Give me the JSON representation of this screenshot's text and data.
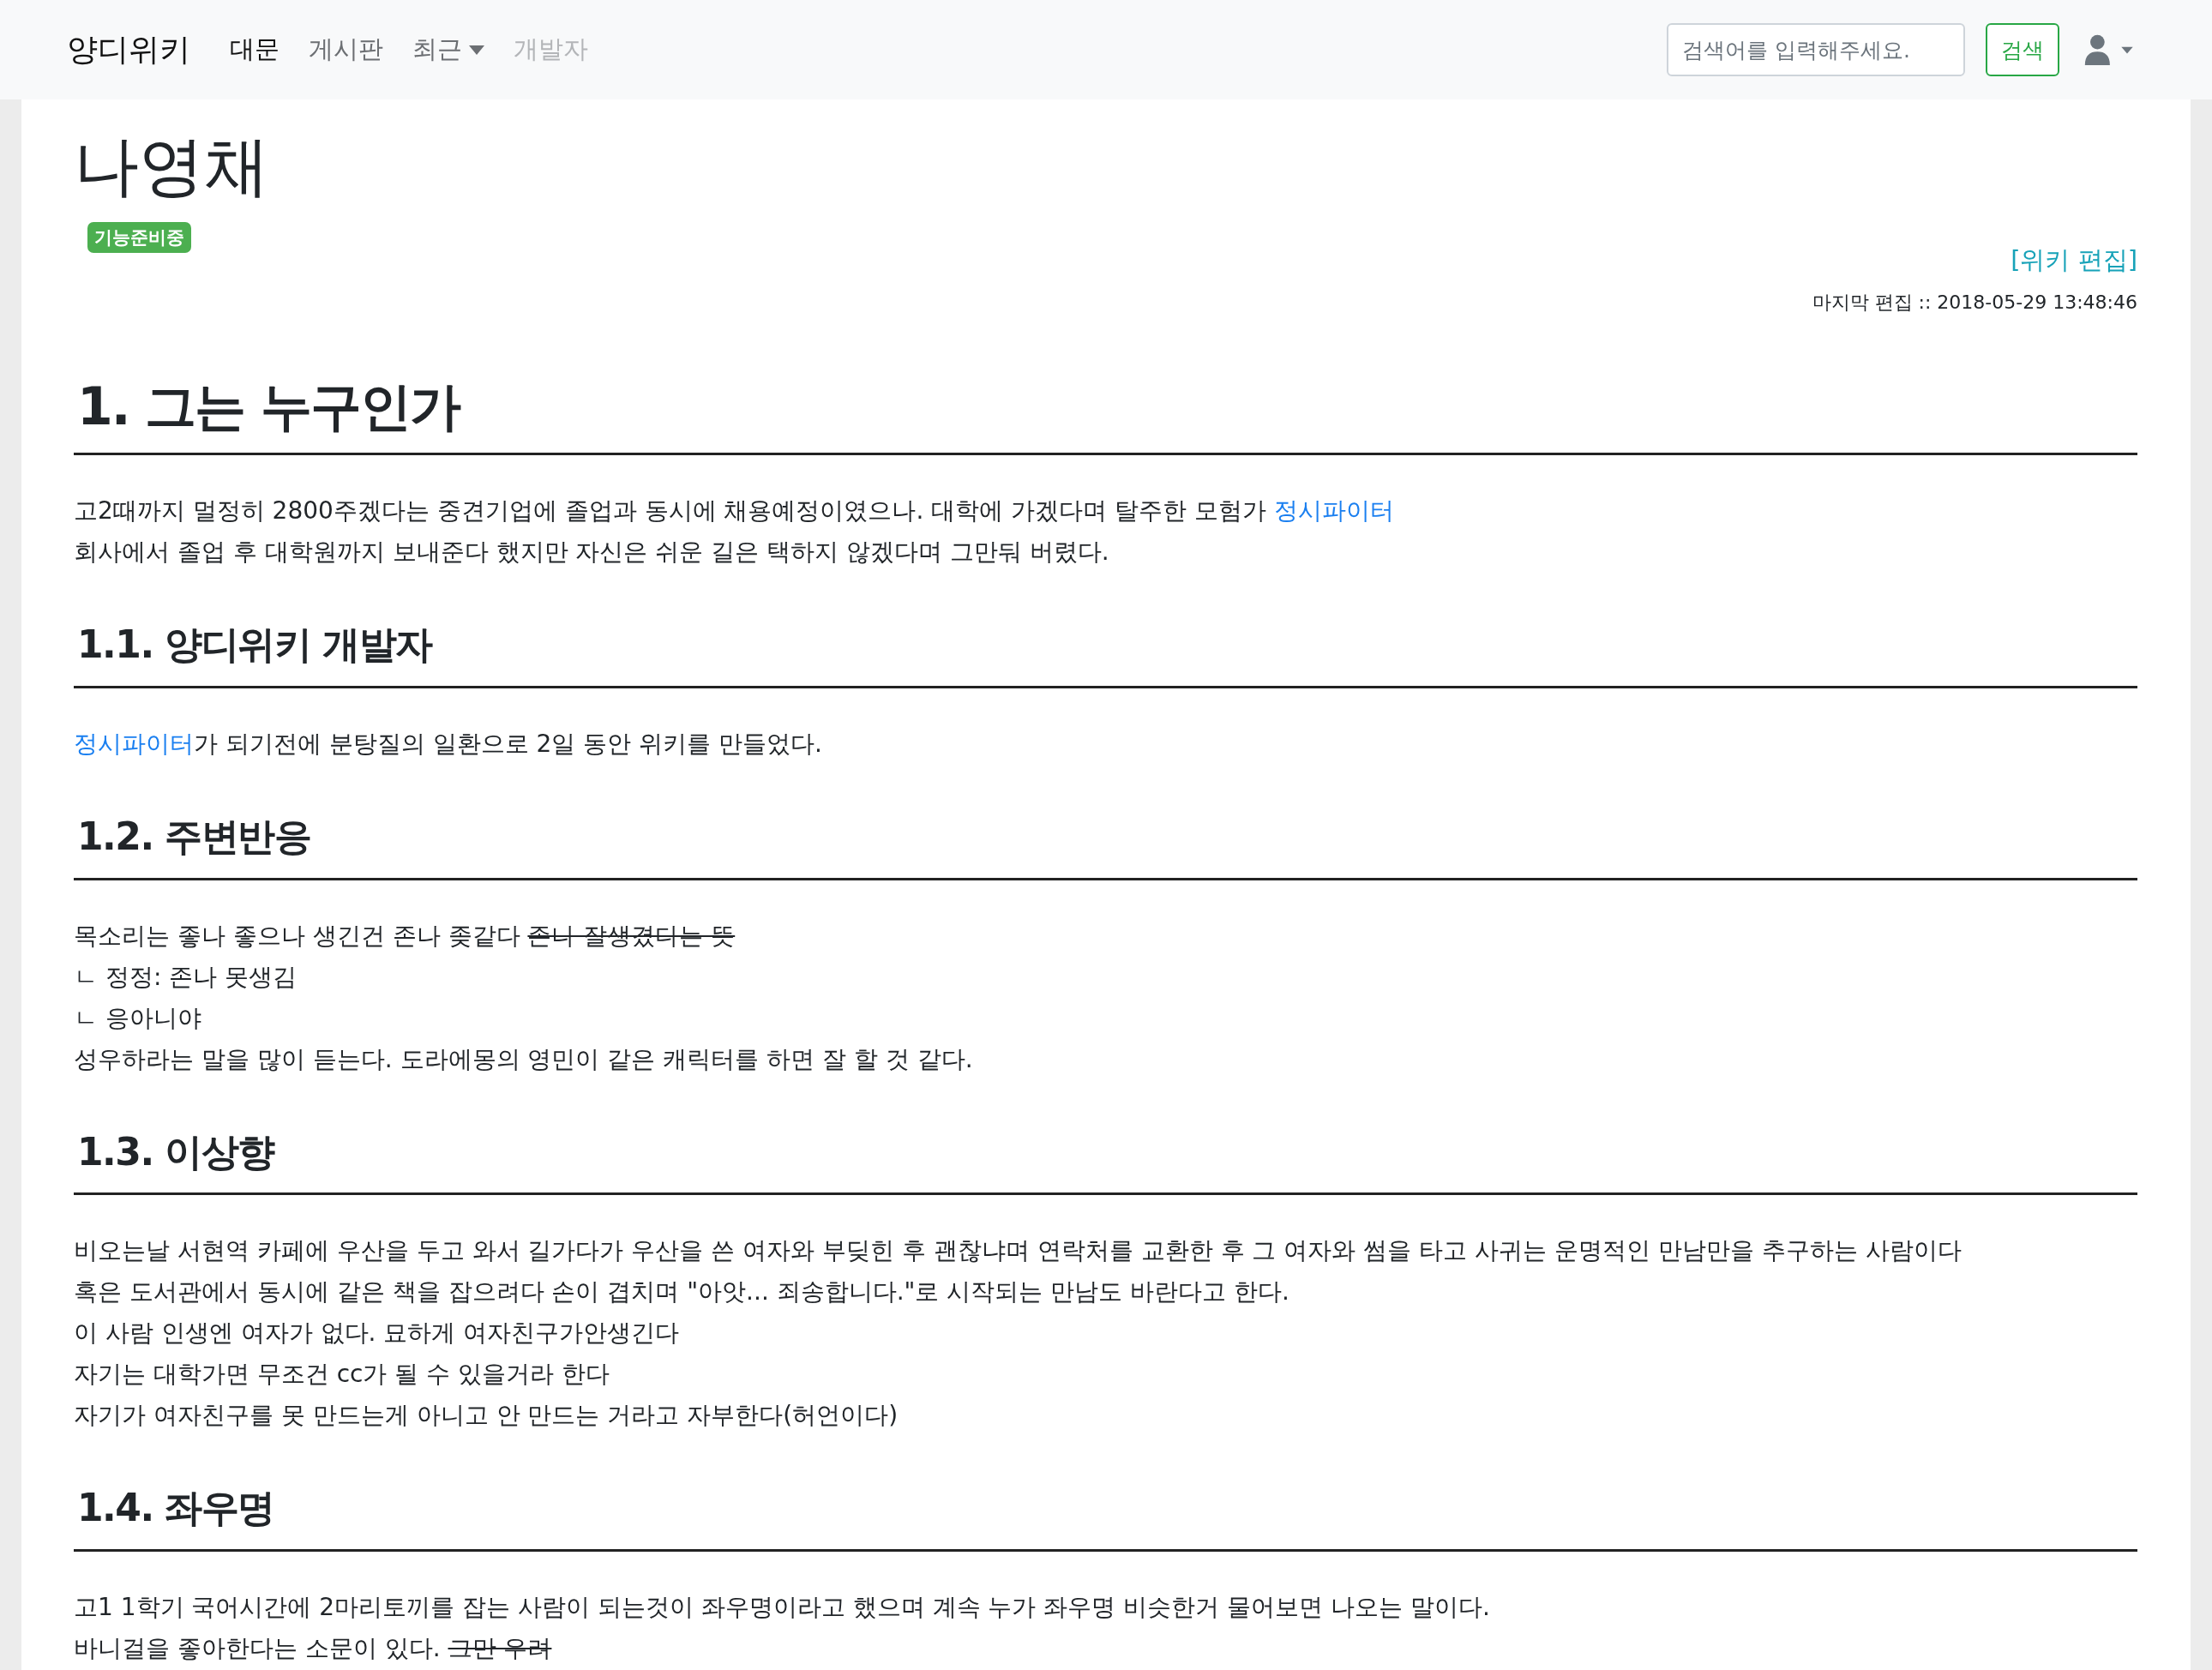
{
  "navbar": {
    "brand": "양디위키",
    "items": [
      {
        "label": "대문",
        "selected": true,
        "disabled": false,
        "dropdown": false
      },
      {
        "label": "게시판",
        "selected": false,
        "disabled": false,
        "dropdown": false
      },
      {
        "label": "최근",
        "selected": false,
        "disabled": false,
        "dropdown": true
      },
      {
        "label": "개발자",
        "selected": false,
        "disabled": true,
        "dropdown": false
      }
    ],
    "search": {
      "placeholder": "검색어를 입력해주세요.",
      "button": "검색"
    }
  },
  "page": {
    "title": "나영채",
    "badge": "기능준비중",
    "edit_link": "[위키 편집]",
    "last_edit": "마지막 편집 :: 2018-05-29 13:48:46"
  },
  "sections": [
    {
      "kind": "h2",
      "heading": "1. 그는 누구인가",
      "lines": [
        [
          {
            "kind": "plain",
            "text": "고2때까지 멀정히 2800주겠다는 중견기업에 졸업과 동시에 채용예정이였으나. 대학에 가겠다며 탈주한 모험가 "
          },
          {
            "kind": "link",
            "text": "정시파이터"
          }
        ],
        [
          {
            "kind": "plain",
            "text": "회사에서 졸업 후 대학원까지 보내준다 했지만 자신은 쉬운 길은 택하지 않겠다며 그만둬 버렸다."
          }
        ]
      ]
    },
    {
      "kind": "h3",
      "heading": "1.1. 양디위키 개발자",
      "lines": [
        [
          {
            "kind": "link",
            "text": "정시파이터"
          },
          {
            "kind": "plain",
            "text": "가 되기전에 분탕질의 일환으로 2일 동안 위키를 만들었다."
          }
        ]
      ]
    },
    {
      "kind": "h3",
      "heading": "1.2. 주변반응",
      "lines": [
        [
          {
            "kind": "plain",
            "text": "목소리는 좋나 좋으나 생긴건 존나 좆같다 "
          },
          {
            "kind": "strike",
            "text": "존나 잘생겼다는 뜻"
          }
        ],
        [
          {
            "kind": "plain",
            "text": "ㄴ 정정: 존나 못생김"
          }
        ],
        [
          {
            "kind": "plain",
            "text": "ㄴ 응아니야"
          }
        ],
        [
          {
            "kind": "plain",
            "text": "성우하라는 말을 많이 듣는다. 도라에몽의 영민이 같은 캐릭터를 하면 잘 할 것 같다."
          }
        ]
      ]
    },
    {
      "kind": "h3",
      "heading": "1.3. 이상향",
      "lines": [
        [
          {
            "kind": "plain",
            "text": "비오는날 서현역 카페에 우산을 두고 와서 길가다가 우산을 쓴 여자와 부딪힌 후 괜찮냐며 연락처를 교환한 후 그 여자와 썸을 타고 사귀는 운명적인 만남만을 추구하는 사람이다"
          }
        ],
        [
          {
            "kind": "plain",
            "text": "혹은 도서관에서 동시에 같은 책을 잡으려다 손이 겹치며 \"아앗... 죄송합니다.\"로 시작되는 만남도 바란다고 한다."
          }
        ],
        [
          {
            "kind": "plain",
            "text": "이 사람 인생엔 여자가 없다. 묘하게 여자친구가안생긴다"
          }
        ],
        [
          {
            "kind": "plain",
            "text": "자기는 대학가면 무조건 cc가 될 수 있을거라 한다"
          }
        ],
        [
          {
            "kind": "plain",
            "text": "자기가 여자친구를 못 만드는게 아니고 안 만드는 거라고 자부한다(허언이다)"
          }
        ]
      ]
    },
    {
      "kind": "h3",
      "heading": "1.4. 좌우명",
      "lines": [
        [
          {
            "kind": "plain",
            "text": "고1 1학기 국어시간에 2마리토끼를 잡는 사람이 되는것이 좌우명이라고 했으며 계속 누가 좌우명 비슷한거 물어보면 나오는 말이다."
          }
        ],
        [
          {
            "kind": "plain",
            "text": "바니걸을 좋아한다는 소문이 있다. "
          },
          {
            "kind": "strike",
            "text": "그만 우려"
          }
        ]
      ]
    }
  ]
}
